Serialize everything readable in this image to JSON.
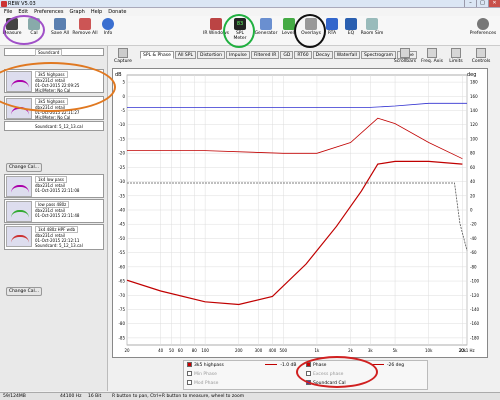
{
  "window": {
    "title": "REW V5.03"
  },
  "menu": [
    "File",
    "Edit",
    "Preferences",
    "Graph",
    "Help",
    "Donate"
  ],
  "toolbar": {
    "left": [
      {
        "label": "Measure",
        "icon": "mic-icon"
      },
      {
        "label": "Cal",
        "icon": "calibrate-icon"
      },
      {
        "label": "Save All",
        "icon": "save-icon"
      },
      {
        "label": "Remove All",
        "icon": "remove-icon"
      },
      {
        "label": "Info",
        "icon": "info-icon"
      }
    ],
    "center": [
      {
        "label": "IR Windows",
        "icon": "ir-windows-icon"
      },
      {
        "label": "SPL Meter",
        "icon": "spl-meter-icon",
        "value": "83"
      },
      {
        "label": "Generator",
        "icon": "generator-icon"
      },
      {
        "label": "Levels",
        "icon": "levels-icon"
      },
      {
        "label": "Overlays",
        "icon": "overlays-icon"
      },
      {
        "label": "RTA",
        "icon": "rta-icon"
      },
      {
        "label": "EQ",
        "icon": "eq-icon"
      },
      {
        "label": "Room Sim",
        "icon": "room-sim-icon"
      }
    ],
    "right": {
      "label": "Preferences",
      "icon": "gear-icon"
    }
  },
  "sidebar": {
    "groups": [
      {
        "items": [
          {
            "name": "Soundcard"
          },
          {
            "name": "3k5 highpass",
            "lines": [
              "dbx231cl retail",
              "01-Oct-2015 22:09:25",
              "Mic/Meter: No Cal",
              "Soundcard: 5_12_13.cal"
            ]
          },
          {
            "name": "3k5 highpass",
            "lines": [
              "dbx231cl retail",
              "01-Oct-2015 22:11:27",
              "Mic/Meter: No Cal",
              "Soundcard: 5_12_13.cal"
            ]
          }
        ],
        "change_label": "Change Cal..."
      },
      {
        "items": [
          {
            "name": "1k4 low pass",
            "lines": [
              "dbx231cl retail",
              "01-Oct-2015 22:11:08"
            ]
          },
          {
            "name": "low pass 480z",
            "lines": [
              "dbx231cl retail",
              "01-Oct-2015 22:11:48"
            ]
          },
          {
            "name": "1k4 480z HPF wdb",
            "lines": [
              "dbx231cl retail",
              "01-Oct-2015 22:12:11",
              "Soundcard: 5_12_13.cal"
            ]
          }
        ],
        "change_label": "Change Cal..."
      }
    ]
  },
  "graph": {
    "capture_label": "Capture",
    "tabs": [
      "SPL & Phase",
      "All SPL",
      "Distortion",
      "Impulse",
      "Filtered IR",
      "GD",
      "RT60",
      "Decay",
      "Waterfall",
      "Spectrogram",
      "Scope"
    ],
    "active_tab": 0,
    "right_tools": [
      "Scrollbars",
      "Freq. Axis",
      "Limits",
      "Controls"
    ],
    "right_unit": "deg"
  },
  "chart_data": {
    "type": "line",
    "x_scale": "log",
    "xlim": [
      20,
      22000
    ],
    "x_ticks": [
      "20",
      "40",
      "50",
      "60",
      "80",
      "100",
      "200",
      "300",
      "400",
      "500",
      "1k",
      "2k",
      "3k",
      "5k",
      "10k",
      "20k",
      "22.1 Hz"
    ],
    "ylim": [
      -90,
      10
    ],
    "y_ticks": [
      "5",
      "0",
      "-5",
      "-10",
      "-15",
      "-20",
      "-25",
      "-30",
      "-35",
      "-40",
      "-45",
      "-50",
      "-55",
      "-60",
      "-65",
      "-70",
      "-75",
      "-80",
      "-85"
    ],
    "y2_ticks": [
      "180",
      "160",
      "140",
      "120",
      "100",
      "80",
      "60",
      "40",
      "20",
      "0",
      "-20",
      "-40",
      "-60",
      "-80",
      "-100",
      "-120",
      "-140",
      "-160",
      "-180"
    ],
    "ylabel": "dB",
    "series": [
      {
        "name": "3k5 highpass",
        "color": "#c00000",
        "x": [
          20,
          40,
          100,
          200,
          400,
          800,
          1500,
          2500,
          3500,
          5000,
          10000,
          20000
        ],
        "y": [
          -66,
          -70,
          -74,
          -75,
          -72,
          -60,
          -46,
          -33,
          -23,
          -22,
          -22,
          -23
        ]
      },
      {
        "name": "Phase",
        "color": "#c00000",
        "x": [
          20,
          100,
          500,
          1000,
          2000,
          3500,
          5000,
          10000,
          20000
        ],
        "y": [
          -18,
          -18,
          -19,
          -19,
          -15,
          -6,
          -8,
          -15,
          -21
        ]
      },
      {
        "name": "Soundcard Cal",
        "color": "#3030d0",
        "x": [
          20,
          1000,
          3000,
          5000,
          10000,
          22000
        ],
        "y": [
          -2,
          -2,
          -2,
          -1.5,
          -0.5,
          -0.5
        ]
      },
      {
        "name": "Min Phase",
        "color": "#555555",
        "x": [
          20,
          1000,
          10000,
          17000,
          19000,
          22000
        ],
        "y": [
          -30,
          -30,
          -30,
          -30,
          -45,
          -55
        ]
      }
    ]
  },
  "legend": {
    "rows": [
      {
        "name": "3k5 highpass",
        "value": "-1.0 dB",
        "checked": true,
        "color": "#c00000"
      },
      {
        "name": "Phase",
        "value": "-26 deg",
        "checked": true,
        "color": "#c00000"
      },
      {
        "name": "Min Phase",
        "value": "",
        "checked": false,
        "color": "#555555"
      },
      {
        "name": "Excess phase",
        "value": "",
        "checked": false,
        "color": "#555555"
      },
      {
        "name": "Mod Phase",
        "value": "",
        "checked": false,
        "color": "#555555"
      },
      {
        "name": "Soundcard Cal",
        "value": "",
        "checked": true,
        "color": "#3030d0"
      }
    ]
  },
  "status": {
    "memory": "59/124MB",
    "rate": "44100 Hz",
    "bits": "16 Bit",
    "hint": "R button to pan, Ctrl+R button to measure, wheel to zoom"
  },
  "highlights": [
    {
      "color": "#a050c8"
    },
    {
      "color": "#e07820"
    },
    {
      "color": "#20b040"
    },
    {
      "color": "#111111"
    },
    {
      "color": "#d02020"
    }
  ]
}
